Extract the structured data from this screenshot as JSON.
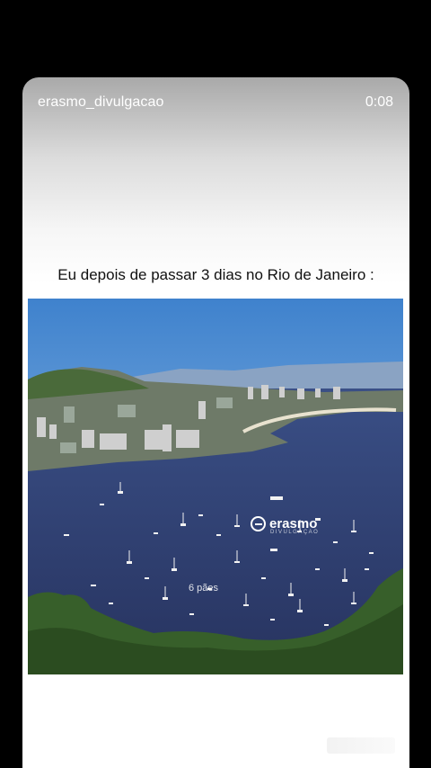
{
  "story": {
    "username": "erasmo_divulgacao",
    "timer": "0:08",
    "caption": "Eu depois de passar 3 dias no Rio de Janeiro :",
    "watermark": "erasmo",
    "watermark_sub": "DIVULGAÇÃO",
    "overlay_text": "6 pães"
  },
  "colors": {
    "background": "#000000",
    "sky": "#4f8ed0",
    "water": "#2e3f72",
    "hills": "#3d6a2f"
  }
}
